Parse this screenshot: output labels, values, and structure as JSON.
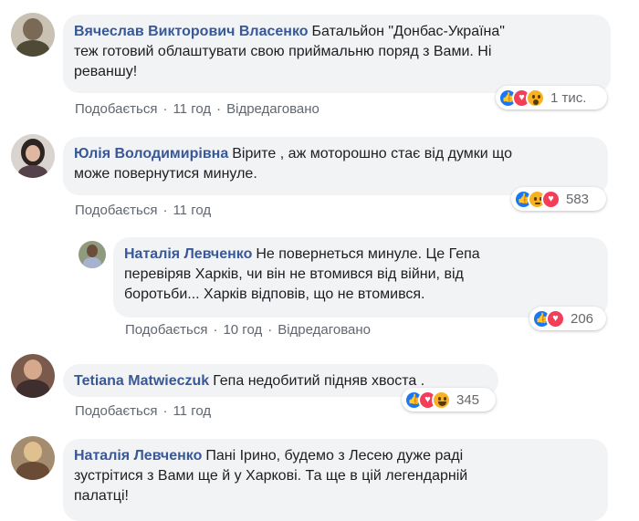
{
  "reactions_legend": {
    "like": "like-icon",
    "love": "love-icon",
    "wow": "wow-icon",
    "sad": "sad-icon",
    "haha": "haha-icon"
  },
  "colors": {
    "author": "#385898",
    "bubble": "#f2f3f5",
    "like": "#1877f2",
    "love": "#f33e58",
    "emoji": "#f7b125"
  },
  "comments": [
    {
      "author": "Вячеслав Викторович Власенко",
      "line1": "Батальйон \"Донбас-Україна\"",
      "line2": "теж готовий облаштувати свою приймальню поряд з Вами. Ні",
      "line3": "реваншу!",
      "like": "Подобається",
      "time": "11 год",
      "edited": "Відредаговано",
      "reaction_count": "1 тис."
    },
    {
      "author": "Юлія Володимирівна",
      "line1": "Вірите , аж моторошно стає від думки що",
      "line2": "може повернутися минуле.",
      "like": "Подобається",
      "time": "11 год",
      "reaction_count": "583"
    },
    {
      "author": "Наталія Левченко",
      "line1": "Не повернеться минуле. Це Гепа",
      "line2": "перевіряв Харків, чи він не втомився від війни, від",
      "line3": "боротьби... Харків відповів, що не втомився.",
      "like": "Подобається",
      "time": "10 год",
      "edited": "Відредаговано",
      "reaction_count": "206"
    },
    {
      "author": "Tetiana Matwieczuk",
      "line1": "Гепа недобитий підняв хвоста .",
      "like": "Подобається",
      "time": "11 год",
      "reaction_count": "345"
    },
    {
      "author": "Наталія Левченко",
      "line1": "Пані Ірино, будемо з Лесею дуже раді",
      "line2": "зустрітися з Вами ще й у Харкові. Та ще в цій легендарній",
      "line3": "палатці!"
    }
  ]
}
